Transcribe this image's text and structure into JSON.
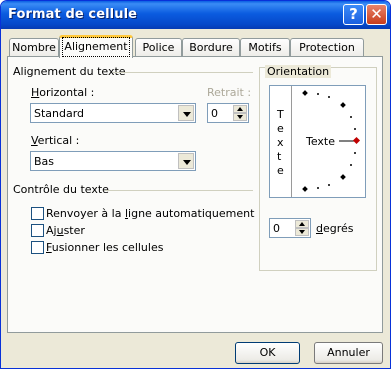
{
  "window": {
    "title": "Format de cellule"
  },
  "titlebar": {
    "help_glyph": "?",
    "close_glyph": "✕"
  },
  "tabs": [
    {
      "label": "Nombre",
      "active": false
    },
    {
      "label": "Alignement",
      "active": true
    },
    {
      "label": "Police",
      "active": false
    },
    {
      "label": "Bordure",
      "active": false
    },
    {
      "label": "Motifs",
      "active": false
    },
    {
      "label": "Protection",
      "active": false
    }
  ],
  "alignment": {
    "section_label": "Alignement du texte",
    "horizontal_label_pre": "",
    "horizontal_label_u": "H",
    "horizontal_label_post": "orizontal :",
    "horizontal_value": "Standard",
    "retrait_label": "Retrait :",
    "retrait_value": "0",
    "vertical_label_u": "V",
    "vertical_label_post": "ertical :",
    "vertical_value": "Bas"
  },
  "text_control": {
    "section_label": "Contrôle du texte",
    "options": [
      {
        "pre": "Renvoyer à la ",
        "u": "l",
        "post": "igne automatiquement",
        "checked": false
      },
      {
        "pre": "Aj",
        "u": "u",
        "post": "ster",
        "checked": false
      },
      {
        "pre": "",
        "u": "F",
        "post": "usionner les cellules",
        "checked": false
      }
    ]
  },
  "orientation": {
    "section_label": "Orientation",
    "vertical_letters": [
      "T",
      "e",
      "x",
      "t",
      "e"
    ],
    "dial_label": "Texte",
    "degrees_value": "0",
    "degrees_label_pre": "",
    "degrees_label_u": "d",
    "degrees_label_post": "egrés"
  },
  "buttons": {
    "ok": "OK",
    "cancel": "Annuler"
  },
  "colors": {
    "title_bar": "#0a5fe3",
    "dialog_bg": "#ece9d8",
    "active_tab_accent": "#ffc83c",
    "dial_marker": "#c00000"
  }
}
